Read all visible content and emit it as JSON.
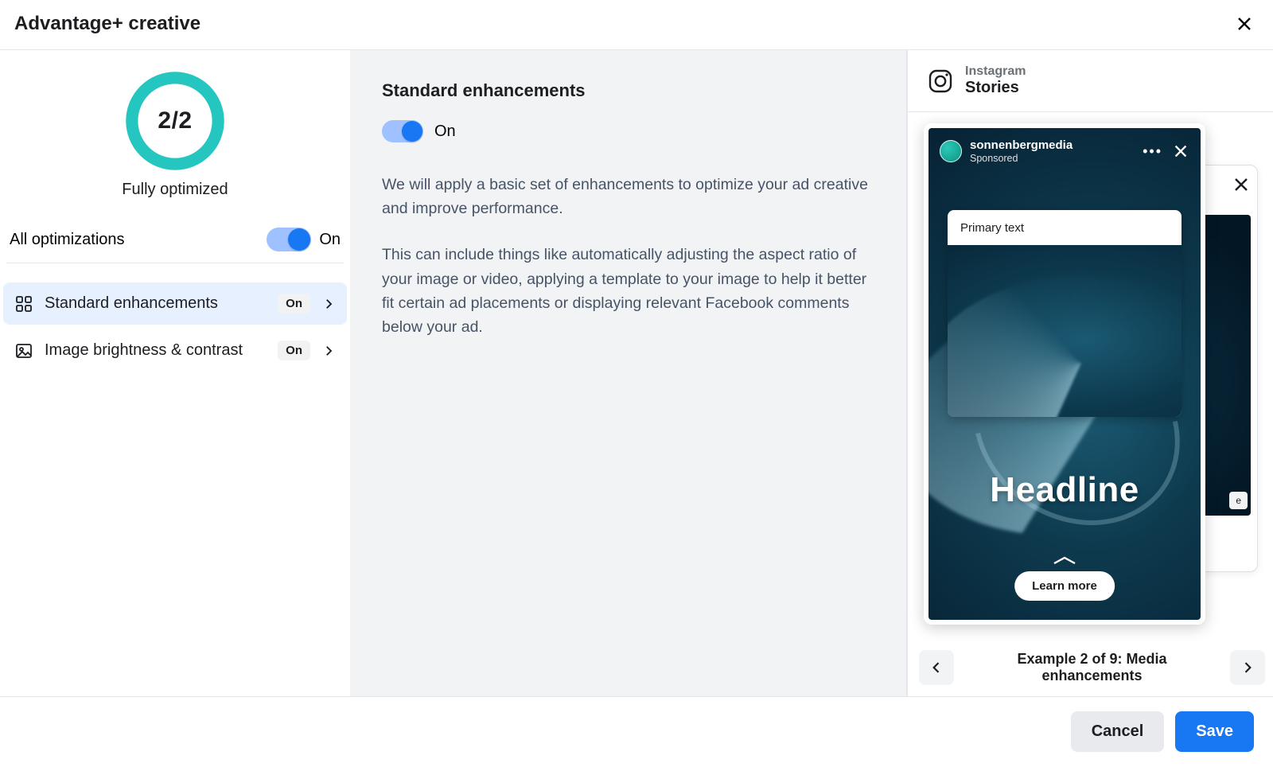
{
  "header": {
    "title": "Advantage+ creative"
  },
  "gauge": {
    "count_label": "2/2",
    "caption": "Fully optimized"
  },
  "all_opt": {
    "label": "All optimizations",
    "state_label": "On"
  },
  "list": {
    "items": [
      {
        "name": "Standard enhancements",
        "state": "On"
      },
      {
        "name": "Image brightness & contrast",
        "state": "On"
      }
    ]
  },
  "detail": {
    "title": "Standard enhancements",
    "toggle_label": "On",
    "para1": "We will apply a basic set of enhancements to optimize your ad creative and improve performance.",
    "para2": "This can include things like automatically adjusting the aspect ratio of your image or video, applying a template to your image to help it better fit certain ad placements or displaying relevant Facebook comments below your ad."
  },
  "preview": {
    "platform": "Instagram",
    "placement": "Stories",
    "account": {
      "username": "sonnenbergmedia",
      "tag": "Sponsored"
    },
    "primary_text_label": "Primary text",
    "headline": "Headline",
    "cta": "Learn more",
    "background_cta_hint": "e",
    "pager_caption": "Example 2 of 9: Media enhancements"
  },
  "footer": {
    "cancel": "Cancel",
    "save": "Save"
  }
}
